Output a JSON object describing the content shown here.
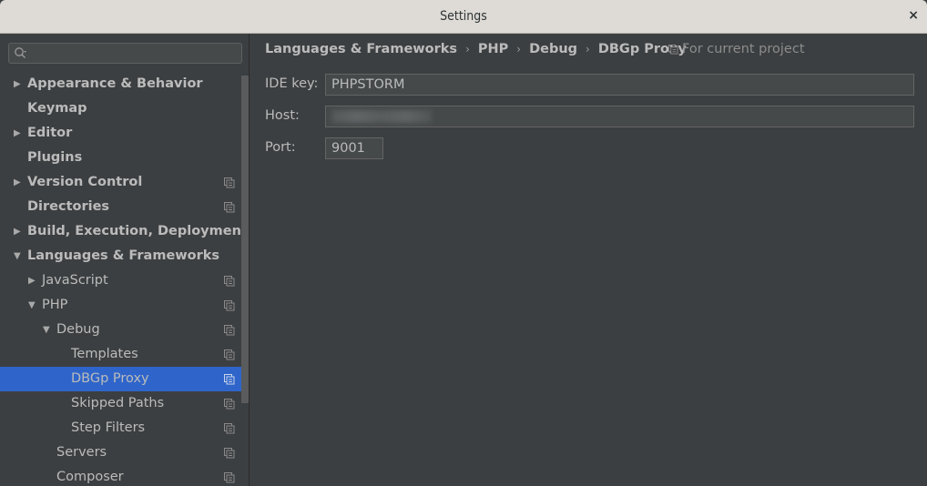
{
  "window": {
    "title": "Settings",
    "close_label": "×"
  },
  "sidebar": {
    "search": {
      "placeholder": "",
      "value": ""
    },
    "items": [
      {
        "label": "Appearance & Behavior",
        "level": 0,
        "arrow": "right",
        "bold": true,
        "project": false
      },
      {
        "label": "Keymap",
        "level": 0,
        "arrow": "none",
        "bold": true,
        "project": false
      },
      {
        "label": "Editor",
        "level": 0,
        "arrow": "right",
        "bold": true,
        "project": false
      },
      {
        "label": "Plugins",
        "level": 0,
        "arrow": "none",
        "bold": true,
        "project": false
      },
      {
        "label": "Version Control",
        "level": 0,
        "arrow": "right",
        "bold": true,
        "project": true
      },
      {
        "label": "Directories",
        "level": 0,
        "arrow": "none",
        "bold": true,
        "project": true
      },
      {
        "label": "Build, Execution, Deployment",
        "level": 0,
        "arrow": "right",
        "bold": true,
        "project": false
      },
      {
        "label": "Languages & Frameworks",
        "level": 0,
        "arrow": "down",
        "bold": true,
        "project": false
      },
      {
        "label": "JavaScript",
        "level": 1,
        "arrow": "right",
        "bold": false,
        "project": true
      },
      {
        "label": "PHP",
        "level": 1,
        "arrow": "down",
        "bold": false,
        "project": true
      },
      {
        "label": "Debug",
        "level": 2,
        "arrow": "down",
        "bold": false,
        "project": true
      },
      {
        "label": "Templates",
        "level": 3,
        "arrow": "none",
        "bold": false,
        "project": true
      },
      {
        "label": "DBGp Proxy",
        "level": 3,
        "arrow": "none",
        "bold": false,
        "project": true,
        "selected": true
      },
      {
        "label": "Skipped Paths",
        "level": 3,
        "arrow": "none",
        "bold": false,
        "project": true
      },
      {
        "label": "Step Filters",
        "level": 3,
        "arrow": "none",
        "bold": false,
        "project": true
      },
      {
        "label": "Servers",
        "level": 2,
        "arrow": "none",
        "bold": false,
        "project": true
      },
      {
        "label": "Composer",
        "level": 2,
        "arrow": "none",
        "bold": false,
        "project": true
      }
    ]
  },
  "content": {
    "breadcrumb": [
      "Languages & Frameworks",
      "PHP",
      "Debug",
      "DBGp Proxy"
    ],
    "breadcrumb_separator": "›",
    "scope_label": "For current project",
    "fields": {
      "ide_key": {
        "label": "IDE key:",
        "value": "PHPSTORM"
      },
      "host": {
        "label": "Host:",
        "value": "[redacted]"
      },
      "port": {
        "label": "Port:",
        "value": "9001"
      }
    }
  },
  "colors": {
    "selection": "#2f65ca",
    "background": "#3c3f41",
    "text": "#bbbbbb"
  }
}
